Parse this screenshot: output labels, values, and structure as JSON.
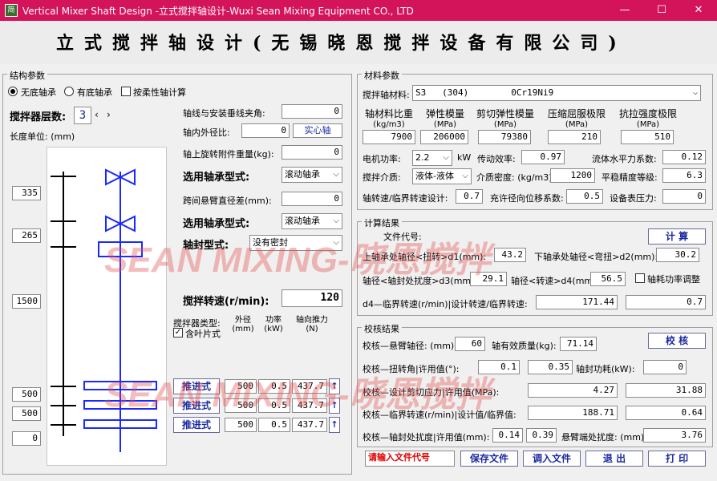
{
  "window": {
    "title": "Vertical Mixer Shaft Design -立式搅拌轴设计-Wuxi Sean Mixing Equipment CO., LTD",
    "icon_text": "简",
    "minimize": "—",
    "maximize": "☐",
    "close": "✕"
  },
  "banner_title": "立式搅拌轴设计(无锡晓恩搅拌设备有限公司)",
  "watermark": "SEAN MIXING-晓恩搅拌",
  "structure": {
    "group_title": "结构参数",
    "radio_no_bearing": "无底轴承",
    "radio_with_bearing": "有底轴承",
    "check_flexible": "按柔性轴计算",
    "layers_label": "搅拌器层数:",
    "layers_value": "3",
    "length_unit": "长度单位: (mm)",
    "dims": [
      "335",
      "265",
      "1500",
      "500",
      "500",
      "0"
    ],
    "angle_label": "轴线与安装垂线夹角:",
    "angle_value": "0",
    "diameter_ratio_label": "轴内外径比:",
    "diameter_ratio_value": "0",
    "solid_shaft": "实心轴",
    "weight_label": "轴上旋转附件重量(kg):",
    "weight_value": "0",
    "bearing_type_label": "选用轴承型式:",
    "bearing_type_value": "滚动轴承",
    "span_label": "跨间悬臂直径差(mm):",
    "span_value": "0",
    "bearing_type2_label": "选用轴承型式:",
    "bearing_type2_value": "滚动轴承",
    "seal_label": "轴封型式:",
    "seal_value": "没有密封",
    "speed_label": "搅拌转速(r/min):",
    "speed_value": "120",
    "mixer_type_header": "搅拌器类型:",
    "blade_check": "含叶片式",
    "col_diameter": "外径\n(mm)",
    "col_power": "功率\n(kW)",
    "col_thrust": "轴向推力\n(N)",
    "mixers": [
      {
        "type": "推进式",
        "diameter": "500",
        "power": "0.5",
        "thrust": "437.7"
      },
      {
        "type": "推进式",
        "diameter": "500",
        "power": "0.5",
        "thrust": "437.7"
      },
      {
        "type": "推进式",
        "diameter": "500",
        "power": "0.5",
        "thrust": "437.7"
      }
    ]
  },
  "material": {
    "group_title": "材料参数",
    "material_label": "搅拌轴材料:",
    "material_value": "S3   (304)        0Cr19Ni9",
    "props": [
      {
        "label": "轴材料比重",
        "unit": "(kg/m3)",
        "value": "7900"
      },
      {
        "label": "弹性模量",
        "unit": "(MPa)",
        "value": "206000"
      },
      {
        "label": "剪切弹性模量",
        "unit": "(MPa)",
        "value": "79380"
      },
      {
        "label": "压缩屈服极限",
        "unit": "(MPa)",
        "value": "210"
      },
      {
        "label": "抗拉强度极限",
        "unit": "(MPa)",
        "value": "510"
      }
    ],
    "motor_power_label": "电机功率:",
    "motor_power_value": "2.2",
    "motor_power_unit": "kW",
    "efficiency_label": "传动效率:",
    "efficiency_value": "0.97",
    "flow_coef_label": "流体水平力系数:",
    "flow_coef_value": "0.12",
    "medium_label": "搅拌介质:",
    "medium_value": "液体-液体",
    "density_label": "介质密度: (kg/m3)",
    "density_value": "1200",
    "balance_label": "平稳精度等级:",
    "balance_value": "6.3",
    "speed_ratio_label": "轴转速/临界转速设计:",
    "speed_ratio_value": "0.7",
    "displacement_label": "充许径向位移系数:",
    "displacement_value": "0.5",
    "pressure_label": "设备表压力:",
    "pressure_value": "0"
  },
  "calc": {
    "group_title": "计算结果",
    "file_code_label": "文件代号:",
    "calc_button": "计  算",
    "d1_label": "上轴承处轴径<扭转>d1(mm):",
    "d1_value": "43.2",
    "d2_label": "下轴承处轴径<弯扭>d2(mm):",
    "d2_value": "30.2",
    "d3_label": "轴径<轴封处扰度>d3(mm):",
    "d3_value": "29.1",
    "d4_label": "轴径<转速>d4(mm):",
    "d4_value": "56.5",
    "power_adjust": "轴耗功率调整",
    "critical_label": "d4—临界转速(r/min)|设计转速/临界转速:",
    "critical_value": "171.44",
    "critical_ratio": "0.7"
  },
  "check": {
    "group_title": "校核结果",
    "cantilever_label": "校核—悬臂轴径: (mm)",
    "cantilever_value": "60",
    "mass_label": "轴有效质量(kg):",
    "mass_value": "71.14",
    "check_button": "校  核",
    "torsion_label": "校核—扭转角|许用值(°):",
    "torsion_value": "0.1",
    "torsion_allow": "0.35",
    "power_loss_label": "轴封功耗(kW):",
    "power_loss_value": "0",
    "shear_label": "校核—设计剪切应力|许用值(MPa):",
    "shear_value": "4.27",
    "shear_allow": "31.88",
    "crit_label": "校核—临界转速(r/min)|设计值/临界值:",
    "crit_value": "188.71",
    "crit_ratio": "0.64",
    "deflect_label": "校核—轴封处扰度|许用值(mm):",
    "deflect_value": "0.14",
    "deflect_allow": "0.39",
    "cant_deflect_label": "悬臂端处扰度: (mm)",
    "cant_deflect_value": "3.76"
  },
  "footer": {
    "file_code_hint": "请输入文件代号",
    "save": "保存文件",
    "load": "调入文件",
    "exit": "退  出",
    "print": "打  印"
  },
  "colors": {
    "titlebar": "#d4145a",
    "diagram_blue": "#1a2aff",
    "button_text": "#1a2aa0",
    "hint_red": "#e00000"
  }
}
